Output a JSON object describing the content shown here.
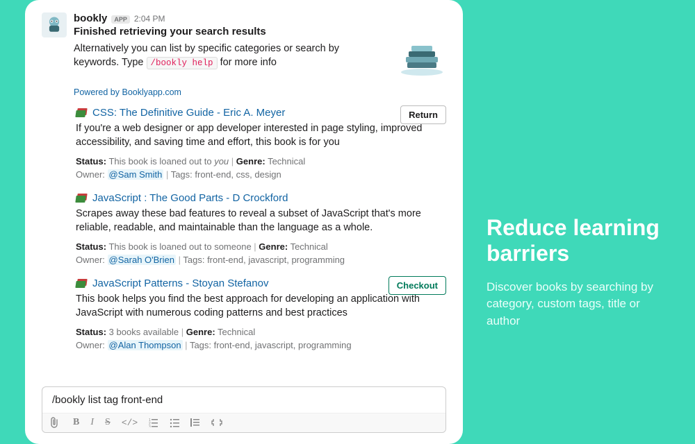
{
  "message": {
    "bot_name": "bookly",
    "app_badge": "APP",
    "timestamp": "2:04 PM",
    "heading": "Finished retrieving your search results",
    "subtext_before": "Alternatively you can list by specific categories or search by keywords. Type ",
    "subtext_code": "/bookly help",
    "subtext_after": " for more info",
    "powered_by": "Powered by Booklyapp.com"
  },
  "results": [
    {
      "title": "CSS: The Definitive Guide - Eric A. Meyer",
      "desc": "If you're a web designer or app developer interested in page styling, improved accessibility, and saving time and effort, this book is for you",
      "status_label": "Status:",
      "status_before": "This book is loaned out to ",
      "status_em": "you",
      "status_after": "",
      "genre_label": "Genre:",
      "genre": "Technical",
      "owner_label": "Owner:",
      "owner_mention": "@Sam Smith",
      "tags_label": "Tags:",
      "tags": "front-end, css, design",
      "action": "Return",
      "action_style": "plain"
    },
    {
      "title": "JavaScript : The Good Parts - D Crockford",
      "desc": "Scrapes away these bad features to reveal a subset of JavaScript that's more reliable, readable, and maintainable than the language as a whole.",
      "status_label": "Status:",
      "status_before": "This book is loaned out to someone",
      "status_em": "",
      "status_after": "",
      "genre_label": "Genre:",
      "genre": "Technical",
      "owner_label": "Owner:",
      "owner_mention": "@Sarah O'Brien",
      "tags_label": "Tags:",
      "tags": "front-end, javascript, programming",
      "action": "",
      "action_style": ""
    },
    {
      "title": "JavaScript Patterns - Stoyan Stefanov",
      "desc": "This book helps you find the best approach for developing an application with JavaScript with numerous coding patterns and best practices",
      "status_label": "Status:",
      "status_before": "3 books available",
      "status_em": "",
      "status_after": "",
      "genre_label": "Genre:",
      "genre": "Technical",
      "owner_label": "Owner:",
      "owner_mention": "@Alan Thompson",
      "tags_label": "Tags:",
      "tags": "front-end, javascript, programming",
      "action": "Checkout",
      "action_style": "green"
    }
  ],
  "composer": {
    "value": "/bookly list tag front-end"
  },
  "marketing": {
    "title": "Reduce learning barriers",
    "body": "Discover books by searching by category, custom tags, title or author"
  }
}
